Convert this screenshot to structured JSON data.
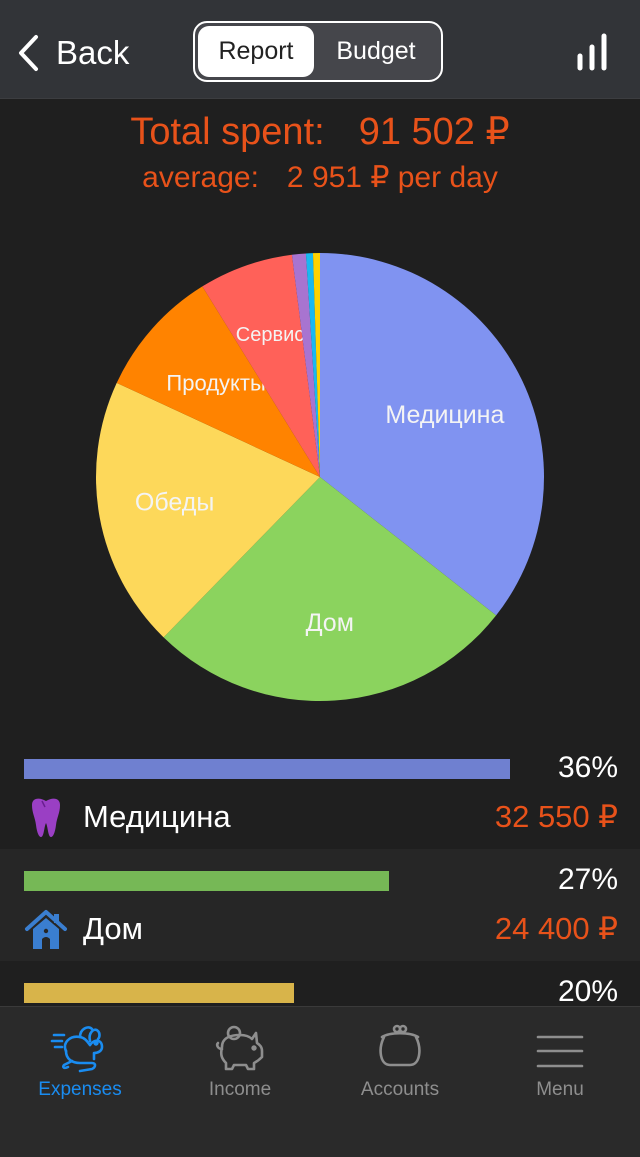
{
  "navbar": {
    "back_label": "Back",
    "segments": [
      {
        "label": "Report",
        "active": true
      },
      {
        "label": "Budget",
        "active": false
      }
    ],
    "chart_icon": "bar-chart-icon"
  },
  "summary": {
    "total_label": "Total spent:",
    "total_value": "91 502 ₽",
    "average_label": "average:",
    "average_value": "2 951 ₽ per day"
  },
  "chart_data": {
    "type": "pie",
    "title": "",
    "slices": [
      {
        "label": "Медицина",
        "value": 35.6,
        "color": "#8093f1",
        "show_label": true
      },
      {
        "label": "Дом",
        "value": 26.7,
        "color": "#8bd35e",
        "show_label": true
      },
      {
        "label": "Обеды",
        "value": 19.6,
        "color": "#fdd85a",
        "show_label": true
      },
      {
        "label": "Продукты",
        "value": 9.3,
        "color": "#ff8300",
        "show_label": true
      },
      {
        "label": "Сервис",
        "value": 6.8,
        "color": "#ff6159",
        "show_label": true
      },
      {
        "label": "",
        "value": 1.0,
        "color": "#a874d0",
        "show_label": false
      },
      {
        "label": "",
        "value": 0.5,
        "color": "#1ab8f0",
        "show_label": false
      },
      {
        "label": "",
        "value": 0.5,
        "color": "#ffd200",
        "show_label": false
      }
    ],
    "start": "top",
    "direction": "clockwise"
  },
  "categories": [
    {
      "name": "Медицина",
      "percent": "36%",
      "share": 36,
      "amount": "32 550 ₽",
      "bar_color": "#6f80d0",
      "icon": "tooth-icon",
      "icon_color": "#9a3fc4"
    },
    {
      "name": "Дом",
      "percent": "27%",
      "share": 27,
      "amount": "24 400 ₽",
      "bar_color": "#76b856",
      "icon": "house-icon",
      "icon_color": "#3a7ed0"
    },
    {
      "name": "",
      "percent": "20%",
      "share": 20,
      "amount": "",
      "bar_color": "#d8b44a",
      "icon": "",
      "icon_color": ""
    }
  ],
  "tabbar": {
    "tabs": [
      {
        "label": "Expenses",
        "icon": "rabbit-icon",
        "active": true
      },
      {
        "label": "Income",
        "icon": "piggy-bank-icon",
        "active": false
      },
      {
        "label": "Accounts",
        "icon": "purse-icon",
        "active": false
      },
      {
        "label": "Menu",
        "icon": "menu-icon",
        "active": false
      }
    ],
    "active_color": "#1a8cf0",
    "inactive_color": "#8e8e8e"
  },
  "accent_color": "#e8521a"
}
